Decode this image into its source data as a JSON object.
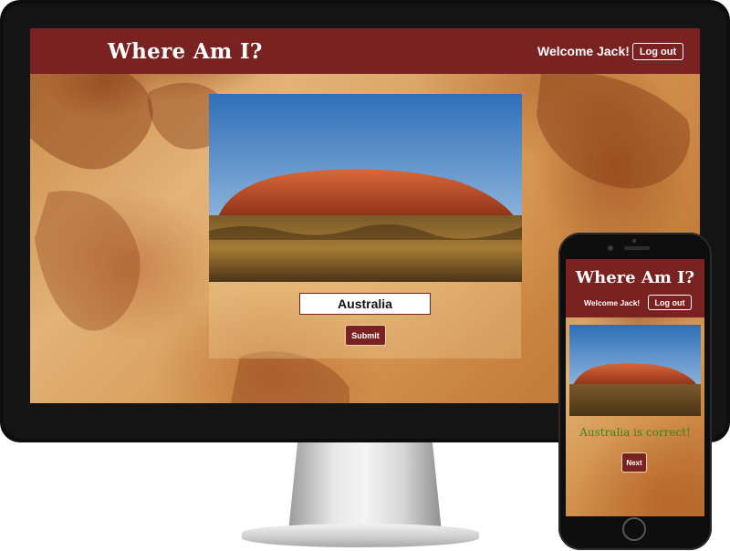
{
  "desktop": {
    "app_title": "Where Am I?",
    "welcome_text": "Welcome Jack!",
    "logout_label": "Log out",
    "guess_input_value": "Australia",
    "submit_label": "Submit"
  },
  "mobile": {
    "app_title": "Where Am I?",
    "welcome_text": "Welcome Jack!",
    "logout_label": "Log out",
    "result_text": "Australia is correct!",
    "next_label": "Next"
  },
  "colors": {
    "brand": "#7a2121",
    "correct": "#2e8a1e",
    "map_background": "#d69a55"
  }
}
